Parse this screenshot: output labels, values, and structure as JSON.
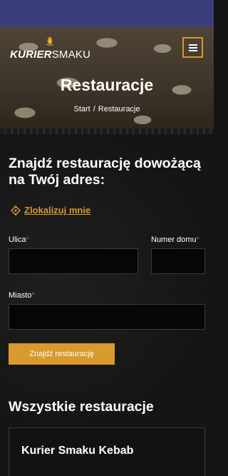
{
  "brand": {
    "name_bold": "KURIER",
    "name_light": "SMAKU"
  },
  "colors": {
    "accent": "#d89a2c",
    "required": "#d14b3c",
    "background": "#151515",
    "status_bar": "#3a3f7a"
  },
  "header": {
    "menu_icon": "hamburger-icon",
    "title": "Restauracje",
    "breadcrumb": {
      "home": "Start",
      "separator": "/",
      "current": "Restauracje"
    }
  },
  "search": {
    "heading": "Znajdź restaurację dowożącą na Twój adres:",
    "locate_icon": "crosshair-icon",
    "locate_label": "Zlokalizuj mnie",
    "fields": {
      "street": {
        "label": "Ulica",
        "required_mark": "*",
        "value": ""
      },
      "house_number": {
        "label": "Numer domu",
        "required_mark": "*",
        "value": ""
      },
      "city": {
        "label": "Miasto",
        "required_mark": "*",
        "value": ""
      }
    },
    "submit_label": "Znajdź restaurację"
  },
  "restaurants": {
    "heading": "Wszystkie restauracje",
    "items": [
      {
        "name": "Kurier Smaku Kebab"
      }
    ]
  }
}
